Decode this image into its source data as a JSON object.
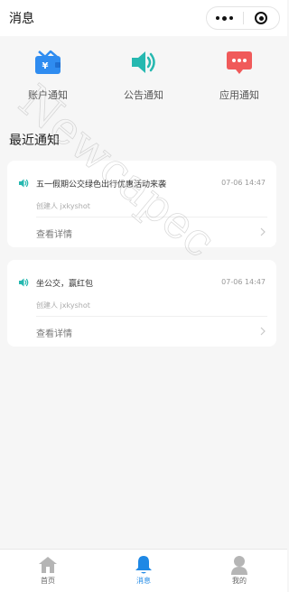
{
  "header": {
    "title": "消息"
  },
  "categories": [
    {
      "label": "账户通知",
      "icon": "wallet-icon",
      "color": "#2f8cf0"
    },
    {
      "label": "公告通知",
      "icon": "speaker-icon",
      "color": "#26b8b0"
    },
    {
      "label": "应用通知",
      "icon": "chat-bubble-icon",
      "color": "#f05a5a"
    }
  ],
  "section_title": "最近通知",
  "notifications": [
    {
      "title": "五一假期公交绿色出行优惠活动来袭",
      "time": "07-06 14:47",
      "creator": "创建人 jxkyshot",
      "detail": "查看详情"
    },
    {
      "title": "坐公交，赢红包",
      "time": "07-06 14:47",
      "creator": "创建人 jxkyshot",
      "detail": "查看详情"
    }
  ],
  "watermark": "Newcapec",
  "tabbar": {
    "items": [
      {
        "label": "首页",
        "icon": "home-icon"
      },
      {
        "label": "消息",
        "icon": "bell-icon",
        "active": true
      },
      {
        "label": "我的",
        "icon": "user-icon"
      }
    ]
  },
  "colors": {
    "accent": "#1e88e5",
    "background": "#f6f6f6"
  }
}
